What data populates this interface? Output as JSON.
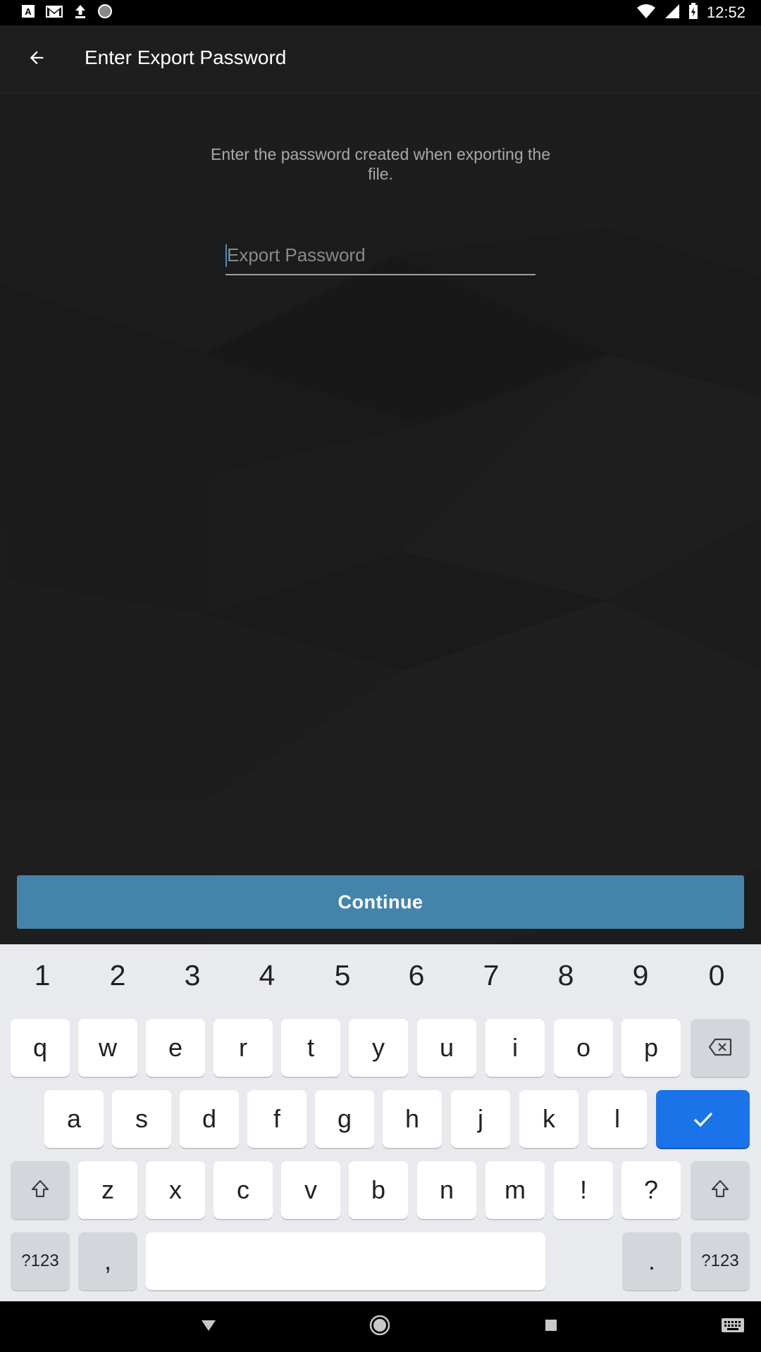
{
  "status_bar": {
    "time": "12:52",
    "left_icons": [
      "font-a-icon",
      "gmail-icon",
      "upload-icon",
      "circle-icon"
    ],
    "right_icons": [
      "wifi-icon",
      "signal-icon",
      "battery-icon"
    ]
  },
  "app_bar": {
    "title": "Enter Export Password",
    "back_icon": "arrow-back-icon"
  },
  "main": {
    "instruction": "Enter the password created when exporting the file.",
    "password_placeholder": "Export Password",
    "password_value": "",
    "continue_label": "Continue",
    "continue_color": "#4584aa"
  },
  "keyboard": {
    "numbers": [
      "1",
      "2",
      "3",
      "4",
      "5",
      "6",
      "7",
      "8",
      "9",
      "0"
    ],
    "row1": [
      "q",
      "w",
      "e",
      "r",
      "t",
      "y",
      "u",
      "i",
      "o",
      "p"
    ],
    "row2": [
      "a",
      "s",
      "d",
      "f",
      "g",
      "h",
      "j",
      "k",
      "l"
    ],
    "row3": [
      "z",
      "x",
      "c",
      "v",
      "b",
      "n",
      "m",
      "!",
      "?"
    ],
    "symbols_label": "?123",
    "comma": ",",
    "period": ".",
    "enter_color": "#1a73e8"
  },
  "nav_bar": {
    "icons": [
      "back-triangle-icon",
      "home-circle-icon",
      "recents-square-icon",
      "keyboard-switch-icon"
    ]
  }
}
